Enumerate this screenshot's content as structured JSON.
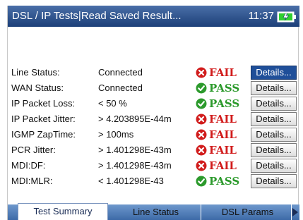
{
  "header": {
    "title": "DSL / IP Tests|Read Saved Result...",
    "time": "11:37"
  },
  "results": [
    {
      "label": "Line Status:",
      "value": "Connected",
      "status": "FAIL",
      "details": "Details..."
    },
    {
      "label": "WAN Status:",
      "value": "Connected",
      "status": "PASS",
      "details": "Details..."
    },
    {
      "label": "IP Packet Loss:",
      "value": "< 50 %",
      "status": "PASS",
      "details": "Details..."
    },
    {
      "label": "IP Packet Jitter:",
      "value": "> 4.203895E-44m",
      "status": "FAIL",
      "details": "Details..."
    },
    {
      "label": "IGMP ZapTime:",
      "value": "> 100ms",
      "status": "FAIL",
      "details": "Details..."
    },
    {
      "label": "PCR Jitter:",
      "value": "> 1.401298E-43m",
      "status": "FAIL",
      "details": "Details..."
    },
    {
      "label": "MDI:DF:",
      "value": "> 1.401298E-43m",
      "status": "FAIL",
      "details": "Details..."
    },
    {
      "label": "MDI:MLR:",
      "value": "< 1.401298E-43",
      "status": "PASS",
      "details": "Details..."
    }
  ],
  "tabs": [
    "Test Summary",
    "Line Status",
    "DSL Params"
  ],
  "colors": {
    "fail": "#d11c1c",
    "pass": "#2c9a2c",
    "titlebar": "#1c3f78",
    "selected_button": "#1f4f99"
  },
  "icons": {
    "fail": "fail-x-icon",
    "pass": "pass-check-icon",
    "battery": "battery-icon",
    "more_tabs": "chevron-right-icon"
  }
}
